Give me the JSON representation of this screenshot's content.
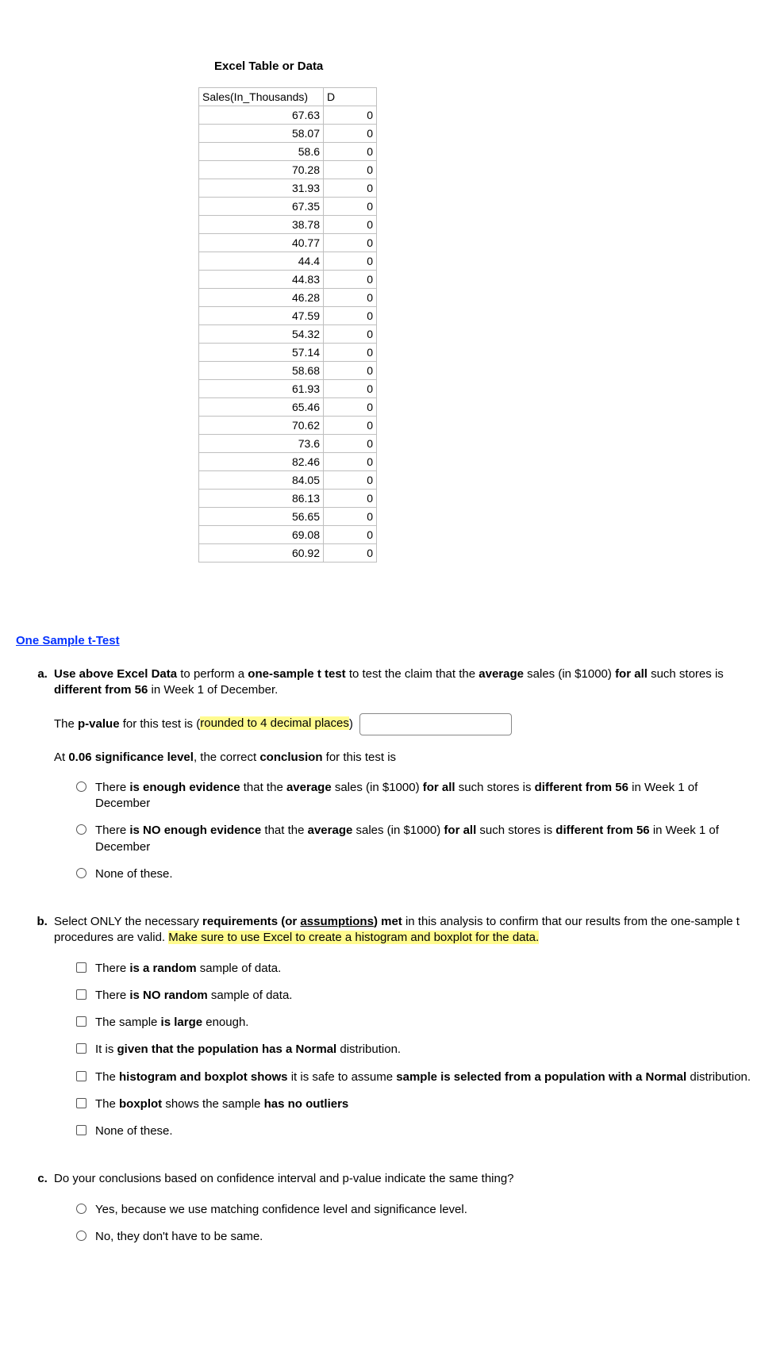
{
  "table_title": "Excel Table or Data",
  "headers": {
    "c1": "Sales(In_Thousands)",
    "c2": "D"
  },
  "rows": [
    {
      "s": "67.63",
      "d": "0"
    },
    {
      "s": "58.07",
      "d": "0"
    },
    {
      "s": "58.6",
      "d": "0"
    },
    {
      "s": "70.28",
      "d": "0"
    },
    {
      "s": "31.93",
      "d": "0"
    },
    {
      "s": "67.35",
      "d": "0"
    },
    {
      "s": "38.78",
      "d": "0"
    },
    {
      "s": "40.77",
      "d": "0"
    },
    {
      "s": "44.4",
      "d": "0"
    },
    {
      "s": "44.83",
      "d": "0"
    },
    {
      "s": "46.28",
      "d": "0"
    },
    {
      "s": "47.59",
      "d": "0"
    },
    {
      "s": "54.32",
      "d": "0"
    },
    {
      "s": "57.14",
      "d": "0"
    },
    {
      "s": "58.68",
      "d": "0"
    },
    {
      "s": "61.93",
      "d": "0"
    },
    {
      "s": "65.46",
      "d": "0"
    },
    {
      "s": "70.62",
      "d": "0"
    },
    {
      "s": "73.6",
      "d": "0"
    },
    {
      "s": "82.46",
      "d": "0"
    },
    {
      "s": "84.05",
      "d": "0"
    },
    {
      "s": "86.13",
      "d": "0"
    },
    {
      "s": "56.65",
      "d": "0"
    },
    {
      "s": "69.08",
      "d": "0"
    },
    {
      "s": "60.92",
      "d": "0"
    }
  ],
  "section_link": " One Sample t-Test",
  "a": {
    "intro_1_1": "Use above Excel Data",
    "intro_1_2": " to perform a ",
    "intro_1_3": "one-sample t test",
    "intro_1_4": " to test the claim that the ",
    "intro_1_5": "average",
    "intro_1_6": " sales (in $1000) ",
    "intro_1_7": "for all",
    "intro_1_8": " such stores is ",
    "intro_1_9": "different from 56",
    "intro_1_10": " in Week 1 of December.",
    "pval_1": "The ",
    "pval_2": "p-value",
    "pval_3": " for this test is (",
    "pval_4": "rounded to 4 decimal places",
    "pval_5": ")",
    "concl_1": "At ",
    "concl_2": "0.06 significance level",
    "concl_3": ", the correct ",
    "concl_4": "conclusion",
    "concl_5": " for this test is",
    "o1_1": "There ",
    "o1_2": "is enough evidence",
    "o1_3": " that the ",
    "o1_4": "average",
    "o1_5": " sales (in $1000) ",
    "o1_6": "for all",
    "o1_7": " such stores is ",
    "o1_8": "different from 56",
    "o1_9": " in Week 1 of December",
    "o2_1": "There ",
    "o2_2": "is NO enough evidence",
    "o2_3": " that the ",
    "o2_4": "average",
    "o2_5": " sales (in $1000) ",
    "o2_6": "for all",
    "o2_7": " such stores is ",
    "o2_8": "different from 56",
    "o2_9": " in Week 1 of December",
    "o3": "None of these."
  },
  "b": {
    "intro_1": "Select ONLY the necessary ",
    "intro_2": "requirements (or ",
    "intro_3": "assumptions",
    "intro_4": ") met",
    "intro_5": " in this analysis to confirm that our results from the one-sample t procedures are valid. ",
    "intro_6": "Make sure to use Excel to create a histogram and boxplot for the data.",
    "c1_1": "There ",
    "c1_2": "is a random",
    "c1_3": " sample of data.",
    "c2_1": "There ",
    "c2_2": "is NO random",
    "c2_3": " sample of data.",
    "c3_1": "The sample ",
    "c3_2": "is large",
    "c3_3": " enough.",
    "c4_1": "It is ",
    "c4_2": "given that the population has a Normal",
    "c4_3": " distribution.",
    "c5_1": "The ",
    "c5_2": "histogram and boxplot shows",
    "c5_3": " it is safe to assume ",
    "c5_4": "sample is selected from a population with a Normal",
    "c5_5": " distribution.",
    "c6_1": "The ",
    "c6_2": "boxplot",
    "c6_3": " shows the sample ",
    "c6_4": "has no outliers",
    ".": ".",
    "c7": "None of these."
  },
  "c": {
    "q": "Do your conclusions based on confidence interval and p-value indicate the same thing?",
    "o1": "Yes, because we use matching confidence level and significance level.",
    "o2": "No, they don't have to be same."
  }
}
